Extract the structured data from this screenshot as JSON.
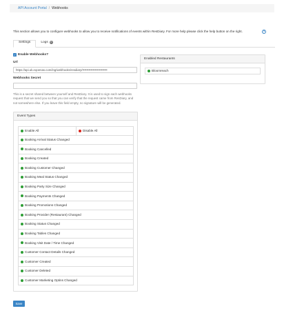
{
  "breadcrumb": {
    "root": "API Account Portal",
    "separator": "/",
    "current": "Webhooks"
  },
  "intro": "This section allows you to configure webhooks to allow you to receive notifications of events within ResDiary. For more help please click the help button on the right.",
  "help_icon_label": "?",
  "tabs": [
    {
      "label": "Settings"
    },
    {
      "label": "Logs",
      "badge": "0"
    }
  ],
  "enable_webhooks": {
    "label": "Enable Webhooks?",
    "checked": true
  },
  "url_field": {
    "label": "Url",
    "value": "https://api.uk.eqoenas.com/ing/webhooks/resdiary/••••••••••••••••••••••••"
  },
  "secret_field": {
    "label": "Webhooks Secret",
    "value": "",
    "help": "This is a secret shared between yourself and ResDiary. It is used to sign each webhooks request that we send you so that you can verify that the request came from ResDiary, and not somewhere else. If you leave this field empty, no signature will be generated."
  },
  "restaurants": {
    "heading": "Enabled Restaurants",
    "items": [
      {
        "name": "Bloomreach",
        "status_color": "#2e9e35"
      }
    ]
  },
  "event_types": {
    "heading": "Event Types",
    "enable_all": "Enable All",
    "disable_all": "Disable All",
    "items": [
      "Booking Arrival Status Changed",
      "Booking Cancelled",
      "Booking Created",
      "Booking Customer Changed",
      "Booking Meal Status Changed",
      "Booking Party Size Changed",
      "Booking Payments Changed",
      "Booking Promotions Changed",
      "Booking Provider (Restaurant) Changed",
      "Booking Status Changed",
      "Booking Tables Changed",
      "Booking Visit Date / Time Changed",
      "Customer Contact Details Changed",
      "Customer Created",
      "Customer Deleted",
      "Customer Marketing Optins Changed"
    ]
  },
  "save_button": "Save",
  "colors": {
    "accent": "#3a85c6",
    "enabled": "#2e9e35",
    "disabled": "#d9251c"
  }
}
